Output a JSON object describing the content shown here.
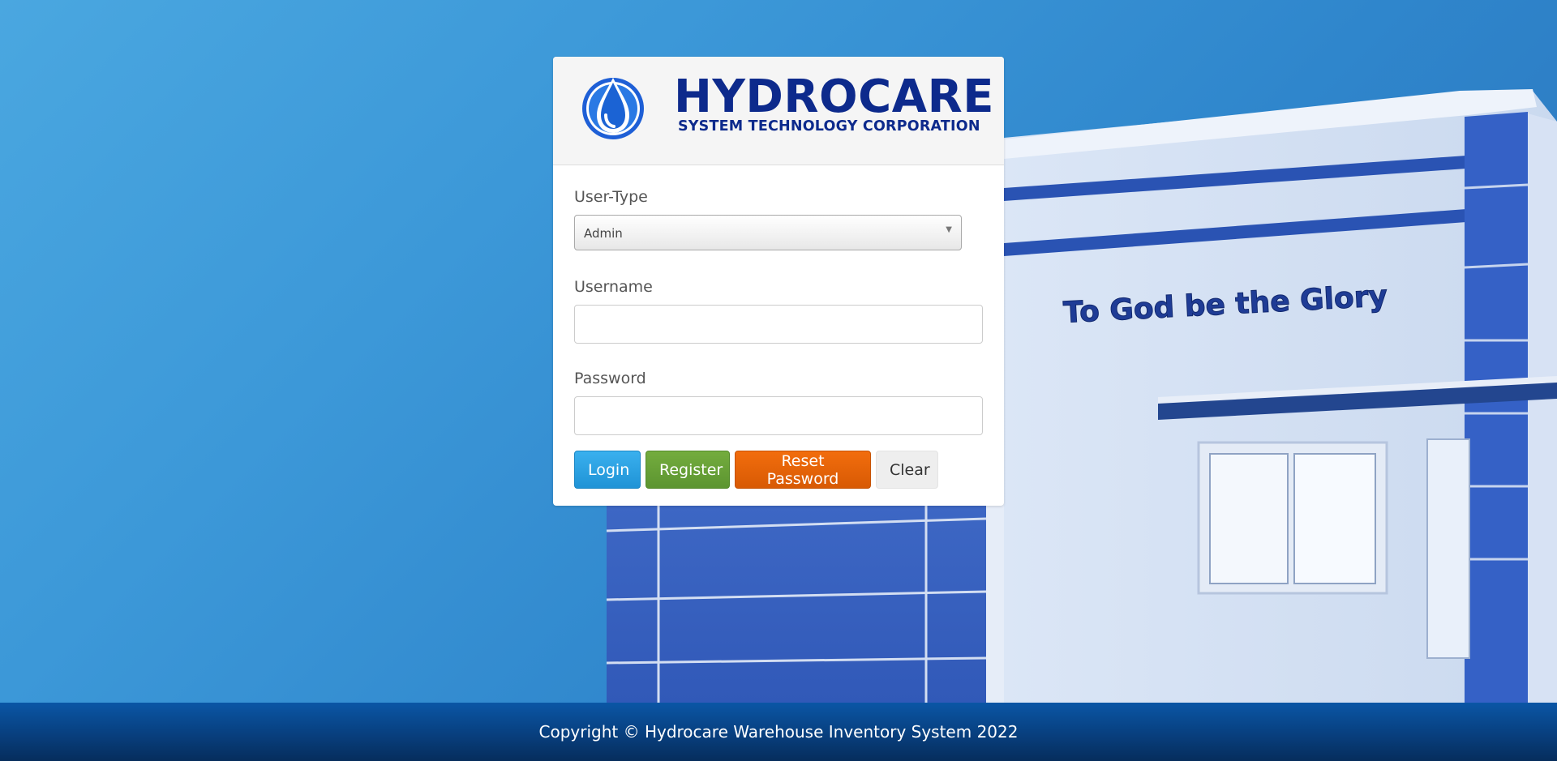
{
  "logo": {
    "name": "HYDROCARE",
    "subtitle": "SYSTEM TECHNOLOGY CORPORATION"
  },
  "background": {
    "building_sign": "To God be the Glory"
  },
  "form": {
    "user_type_label": "User-Type",
    "user_type_value": "Admin",
    "username_label": "Username",
    "username_value": "",
    "password_label": "Password",
    "password_value": ""
  },
  "buttons": {
    "login": "Login",
    "register": "Register",
    "reset_password": "Reset Password",
    "clear": "Clear"
  },
  "footer": {
    "copyright": "Copyright © Hydrocare Warehouse Inventory System 2022"
  },
  "colors": {
    "brand_navy": "#0d2a8c",
    "login_blue": "#1f93d6",
    "register_green": "#5c9530",
    "reset_orange": "#d85a04",
    "footer_blue": "#083f7e"
  },
  "icons": {
    "logo_mark": "water-drop-icon",
    "select_caret": "caret-down-icon"
  }
}
